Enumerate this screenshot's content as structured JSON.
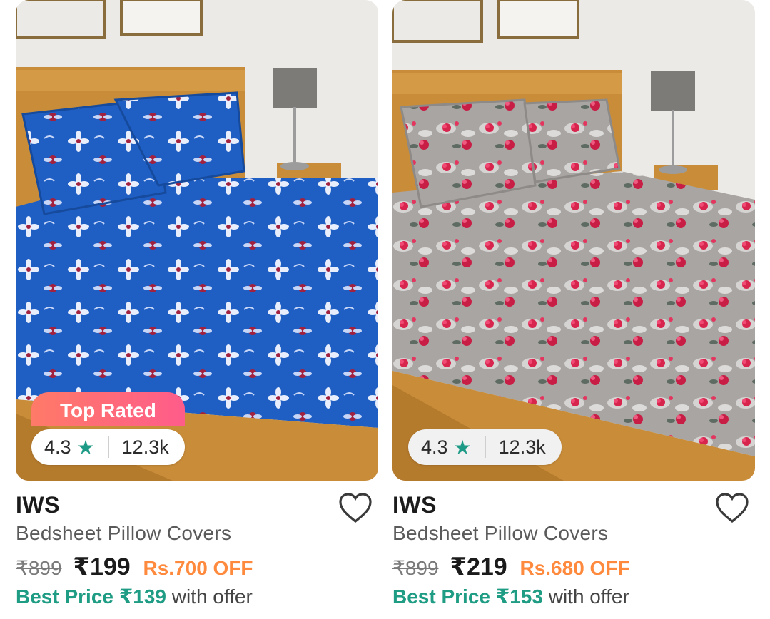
{
  "products": [
    {
      "badge": "Top Rated",
      "rating": "4.3",
      "reviews": "12.3k",
      "brand": "IWS",
      "title": "Bedsheet Pillow Covers",
      "mrp": "₹899",
      "price": "₹199",
      "discount": "Rs.700 OFF",
      "best_label": "Best Price ₹139",
      "best_suffix": "with offer"
    },
    {
      "rating": "4.3",
      "reviews": "12.3k",
      "brand": "IWS",
      "title": "Bedsheet Pillow Covers",
      "mrp": "₹899",
      "price": "₹219",
      "discount": "Rs.680 OFF",
      "best_label": "Best Price ₹153",
      "best_suffix": "with offer"
    }
  ],
  "icons": {
    "star": "star-icon",
    "wishlist": "heart-icon"
  },
  "colors": {
    "rating_star": "#1d9a86",
    "best_price": "#1f9c84",
    "discount": "#ff8a3d",
    "badge": "#ff6a78"
  }
}
